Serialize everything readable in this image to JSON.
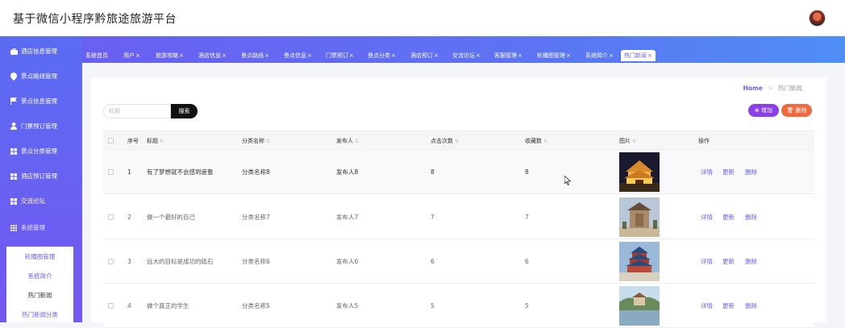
{
  "header": {
    "title": "基于微信小程序黔旅途旅游平台"
  },
  "sidebar": {
    "items": [
      {
        "label": "酒店信息管理",
        "icon": "briefcase-icon"
      },
      {
        "label": "景点路线管理",
        "icon": "map-pin-icon"
      },
      {
        "label": "景点信息管理",
        "icon": "flag-icon"
      },
      {
        "label": "门票预订管理",
        "icon": "user-icon"
      },
      {
        "label": "景点分类管理",
        "icon": "grid-icon"
      },
      {
        "label": "酒店预订管理",
        "icon": "grid-icon"
      },
      {
        "label": "交流论坛",
        "icon": "grid-icon"
      },
      {
        "label": "系统管理",
        "icon": "grid-icon"
      }
    ],
    "sub_items": [
      {
        "label": "轮播图管理"
      },
      {
        "label": "系统简介"
      },
      {
        "label": "热门新闻"
      },
      {
        "label": "热门新闻分类"
      }
    ]
  },
  "tabs": [
    {
      "label": "系统首页",
      "close": ""
    },
    {
      "label": "用户",
      "close": "×"
    },
    {
      "label": "旅游攻略",
      "close": "×"
    },
    {
      "label": "酒店信息",
      "close": "×"
    },
    {
      "label": "景点路线",
      "close": "×"
    },
    {
      "label": "景点信息",
      "close": "×"
    },
    {
      "label": "门票预订",
      "close": "×"
    },
    {
      "label": "景点分类",
      "close": "×"
    },
    {
      "label": "酒店预订",
      "close": "×"
    },
    {
      "label": "交流论坛",
      "close": "×"
    },
    {
      "label": "客服管理",
      "close": "×"
    },
    {
      "label": "轮播图管理",
      "close": "×"
    },
    {
      "label": "系统简介",
      "close": "×"
    },
    {
      "label": "热门新闻",
      "close": "×"
    }
  ],
  "breadcrumb": {
    "home": "Home",
    "sep": ">",
    "current": "热门新闻"
  },
  "search": {
    "placeholder": "标题",
    "button": "搜索"
  },
  "actions": {
    "add": "⊕ 增加",
    "delete": "🗑 删除"
  },
  "table": {
    "headers": {
      "index": "序号",
      "title": "标题",
      "category": "分类名称",
      "publisher": "发布人",
      "clicks": "点击次数",
      "favorites": "收藏数",
      "image": "图片",
      "ops": "操作"
    },
    "sort_glyph": "⇅",
    "rows": [
      {
        "index": "1",
        "title": "有了梦想就不会感到疲惫",
        "category": "分类名称8",
        "publisher": "发布人8",
        "clicks": "8",
        "favorites": "8",
        "image": "night-pagoda-photo"
      },
      {
        "index": "2",
        "title": "做一个最好的自己",
        "category": "分类名称7",
        "publisher": "发布人7",
        "clicks": "7",
        "favorites": "7",
        "image": "stone-tablet-photo"
      },
      {
        "index": "3",
        "title": "远大的目标是成功的砥石",
        "category": "分类名称6",
        "publisher": "发布人6",
        "clicks": "6",
        "favorites": "6",
        "image": "temple-of-heaven-photo"
      },
      {
        "index": "4",
        "title": "做个真正的学生",
        "category": "分类名称5",
        "publisher": "发布人5",
        "clicks": "5",
        "favorites": "5",
        "image": "lake-garden-photo"
      }
    ],
    "op_labels": {
      "detail": "详情",
      "update": "更新",
      "delete": "删除"
    }
  },
  "colors": {
    "accent": "#6a5ff2",
    "sidebar": "#5a6cf2",
    "add": "#8a3fe8",
    "delete": "#ef6a3f"
  }
}
